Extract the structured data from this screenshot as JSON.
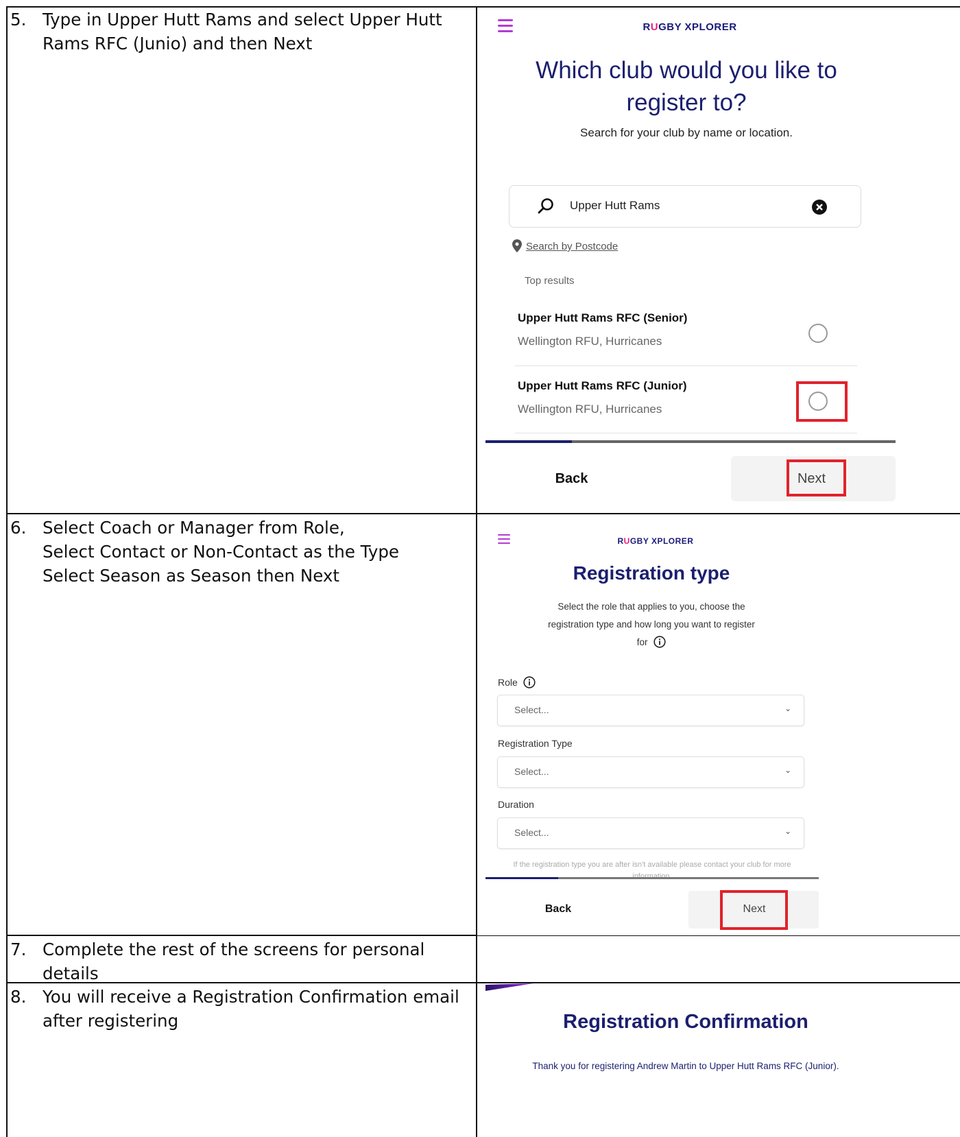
{
  "steps": [
    {
      "num": "5.",
      "text": "Type in Upper Hutt Rams and select Upper Hutt Rams RFC (Junio) and then Next"
    },
    {
      "num": "6.",
      "lines": [
        "Select Coach or Manager from Role,",
        "Select Contact or Non-Contact as the Type",
        "Select Season as Season then Next"
      ]
    },
    {
      "num": "7.",
      "text": "Complete the rest of the screens for personal details"
    },
    {
      "num": "8.",
      "text": "You will receive a Registration Confirmation email after registering"
    }
  ],
  "club_screen": {
    "brand_prefix": "R",
    "brand_u": "U",
    "brand_rest": "GBY XPLORER",
    "title": "Which club would you like to register to?",
    "subtitle": "Search for your club by name or location.",
    "search_value": "Upper Hutt Rams",
    "postcode_link": "Search by Postcode",
    "top_results_label": "Top results",
    "results": [
      {
        "name": "Upper Hutt Rams RFC (Senior)",
        "detail": "Wellington RFU, Hurricanes"
      },
      {
        "name": "Upper Hutt Rams RFC (Junior)",
        "detail": "Wellington RFU, Hurricanes"
      }
    ],
    "back_label": "Back",
    "next_label": "Next"
  },
  "reg_type_screen": {
    "brand_prefix": "R",
    "brand_u": "U",
    "brand_rest": "GBY XPLORER",
    "title": "Registration type",
    "subtitle_lines": [
      "Select the role that applies to you, choose the",
      "registration type and how long you want to register",
      "for"
    ],
    "role_label": "Role",
    "role_placeholder": "Select...",
    "type_label": "Registration Type",
    "type_placeholder": "Select...",
    "duration_label": "Duration",
    "duration_placeholder": "Select...",
    "note": "If the registration type you are after isn't available please contact your club for more information.",
    "back_label": "Back",
    "next_label": "Next"
  },
  "confirmation": {
    "title": "Registration Confirmation",
    "message": "Thank you for registering Andrew Martin to Upper Hutt Rams RFC (Junior)."
  },
  "colors": {
    "brand_navy": "#1b1f6e",
    "highlight_red": "#e1222a",
    "menu_purple": "#b43ad6"
  }
}
